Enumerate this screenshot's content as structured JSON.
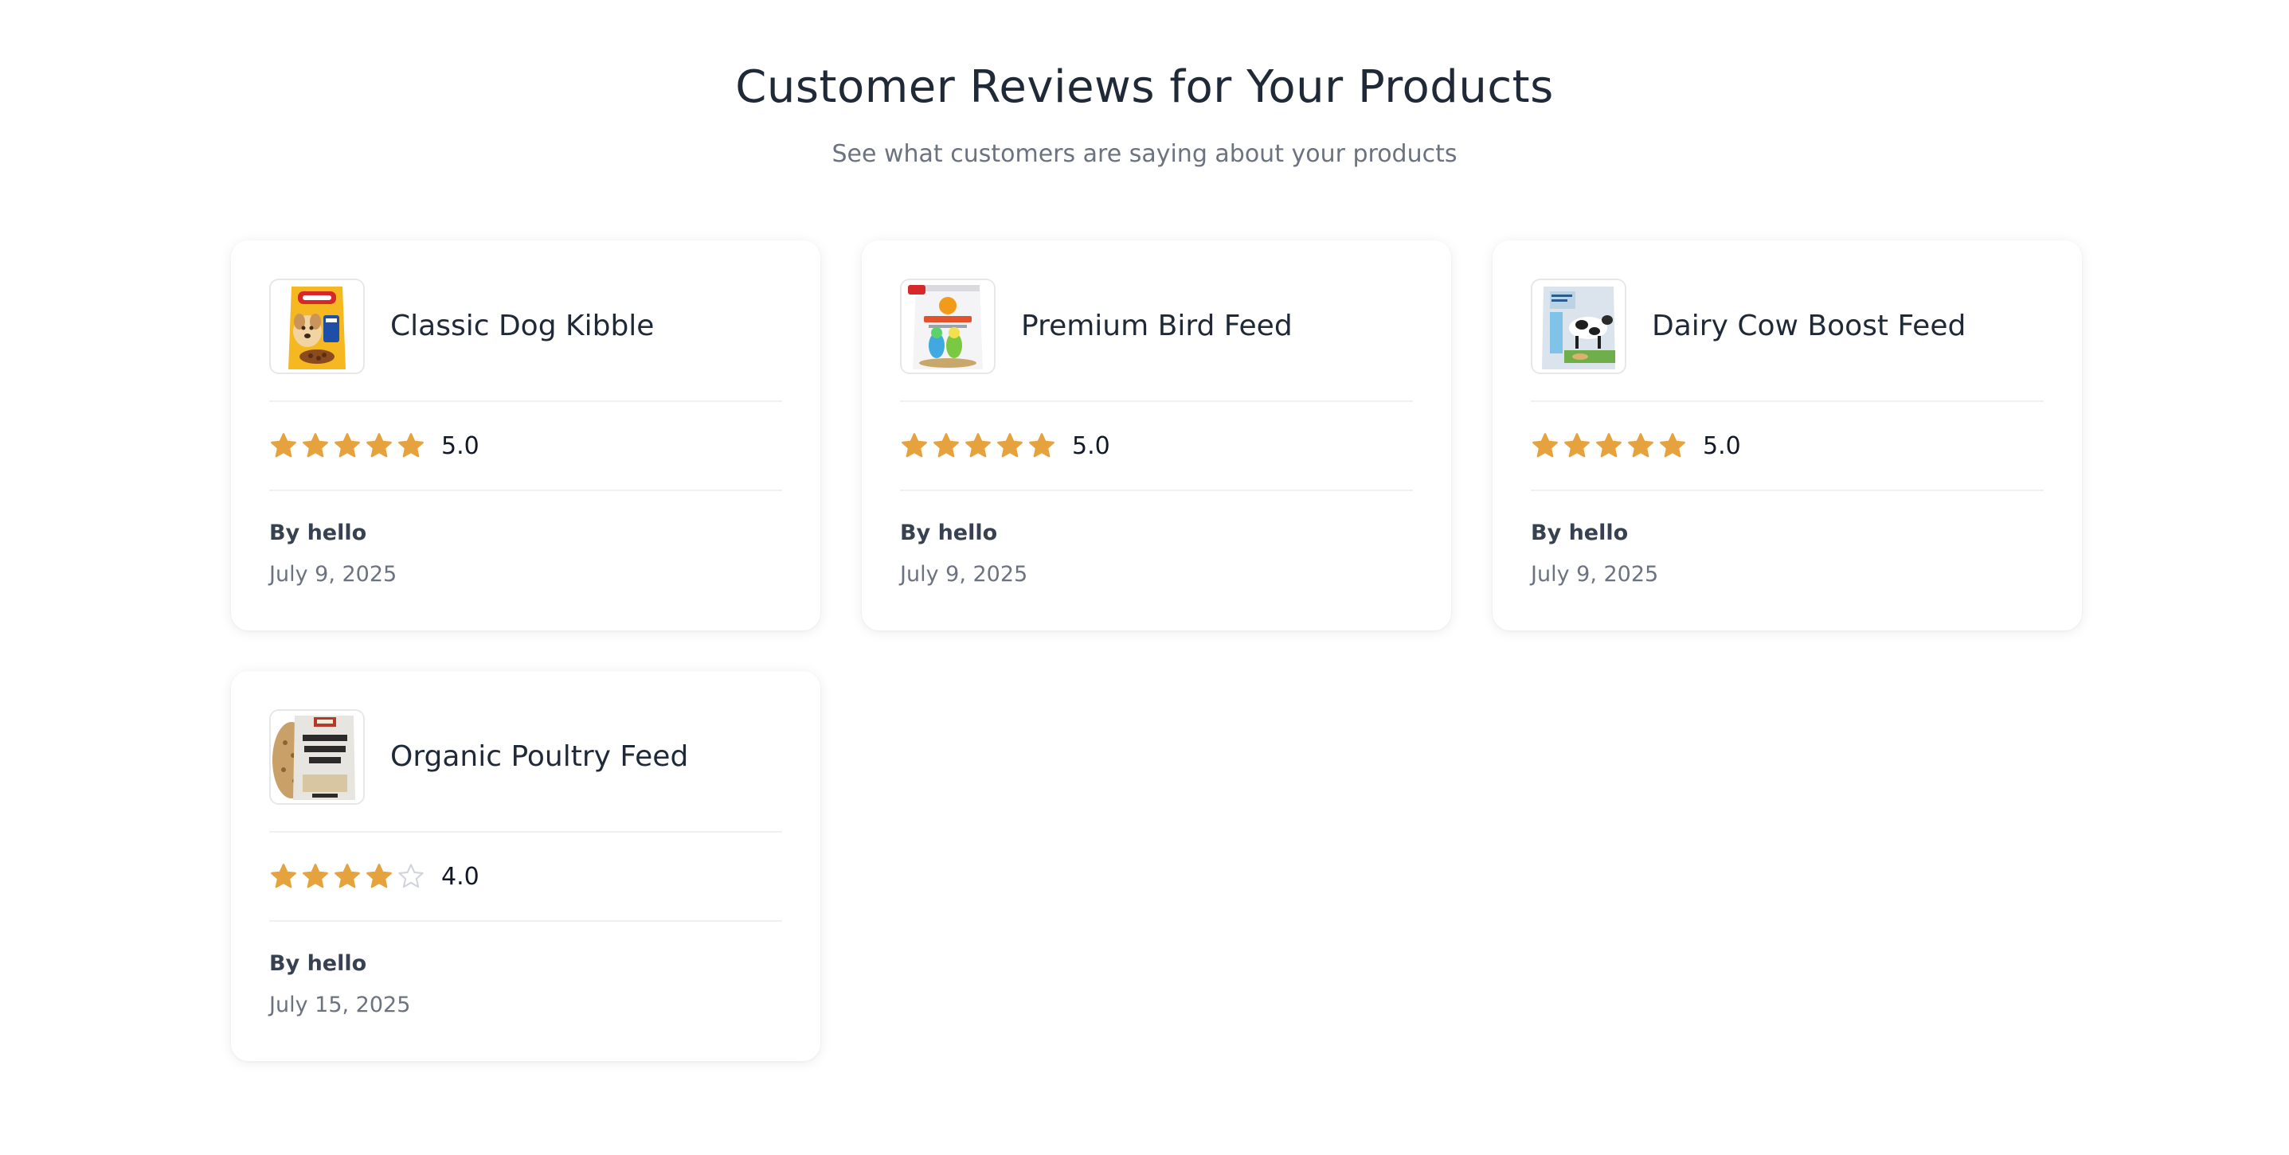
{
  "header": {
    "title": "Customer Reviews for Your Products",
    "subtitle": "See what customers are saying about your products"
  },
  "colors": {
    "star_filled": "#e6a23c",
    "star_empty": "#d1d5db",
    "title": "#1f2937",
    "muted": "#6b7280"
  },
  "reviews": [
    {
      "product_name": "Classic Dog Kibble",
      "thumbnail_icon": "dog-food-bag-icon",
      "rating": 5,
      "rating_label": "5.0",
      "author": "By hello",
      "date": "July 9, 2025"
    },
    {
      "product_name": "Premium Bird Feed",
      "thumbnail_icon": "bird-feed-bag-icon",
      "rating": 5,
      "rating_label": "5.0",
      "author": "By hello",
      "date": "July 9, 2025"
    },
    {
      "product_name": "Dairy Cow Boost Feed",
      "thumbnail_icon": "cattle-feed-bag-icon",
      "rating": 5,
      "rating_label": "5.0",
      "author": "By hello",
      "date": "July 9, 2025"
    },
    {
      "product_name": "Organic Poultry Feed",
      "thumbnail_icon": "poultry-feed-bag-icon",
      "rating": 4,
      "rating_label": "4.0",
      "author": "By hello",
      "date": "July 15, 2025"
    }
  ]
}
